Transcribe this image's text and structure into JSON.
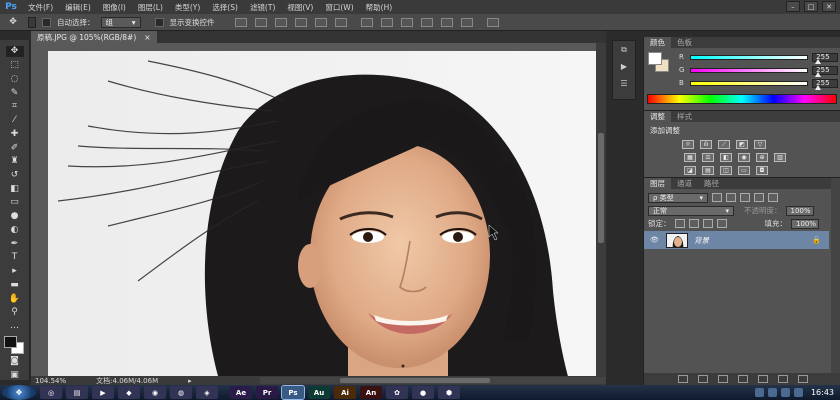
{
  "app": {
    "logo": "Ps",
    "menu": [
      "文件(F)",
      "编辑(E)",
      "图像(I)",
      "图层(L)",
      "类型(Y)",
      "选择(S)",
      "滤镜(T)",
      "视图(V)",
      "窗口(W)",
      "帮助(H)"
    ],
    "window_controls": [
      "–",
      "□",
      "✕"
    ]
  },
  "options_bar": {
    "auto_select_label": "自动选择：",
    "auto_select_value": "组",
    "show_transform_label": "显示变换控件"
  },
  "document": {
    "tab_title": "原稿.JPG @ 105%(RGB/8#)",
    "tab_close": "×",
    "zoom": "104.54%",
    "doc_info": "文档:4.06M/4.06M"
  },
  "panels": {
    "color": {
      "tabs": [
        "颜色",
        "色板"
      ],
      "channels": [
        {
          "label": "R",
          "value": "255",
          "track": "linear-gradient(to right, #00ffff, #ffffff)"
        },
        {
          "label": "G",
          "value": "255",
          "track": "linear-gradient(to right, #ff00ff, #ffffff)"
        },
        {
          "label": "B",
          "value": "255",
          "track": "linear-gradient(to right, #ffff00, #ffffff)"
        }
      ]
    },
    "adjustments": {
      "tabs": [
        "调整",
        "样式"
      ],
      "title": "添加调整"
    },
    "layers": {
      "tabs": [
        "图层",
        "通道",
        "路径"
      ],
      "filter_label": "ρ 类型",
      "blend_mode": "正常",
      "opacity_label": "不透明度：",
      "opacity_value": "100%",
      "lock_label": "锁定：",
      "fill_label": "填充：",
      "fill_value": "100%",
      "layer_name": "背景"
    }
  },
  "taskbar": {
    "apps": [
      {
        "name": "Ae",
        "color": "#2b1b4a"
      },
      {
        "name": "Pr",
        "color": "#2a1845"
      },
      {
        "name": "Ps",
        "color": "#0f2a4a"
      },
      {
        "name": "Au",
        "color": "#0d3a32"
      },
      {
        "name": "Ai",
        "color": "#4a2a08"
      },
      {
        "name": "An",
        "color": "#3a1010"
      }
    ],
    "clock": "16:43"
  }
}
